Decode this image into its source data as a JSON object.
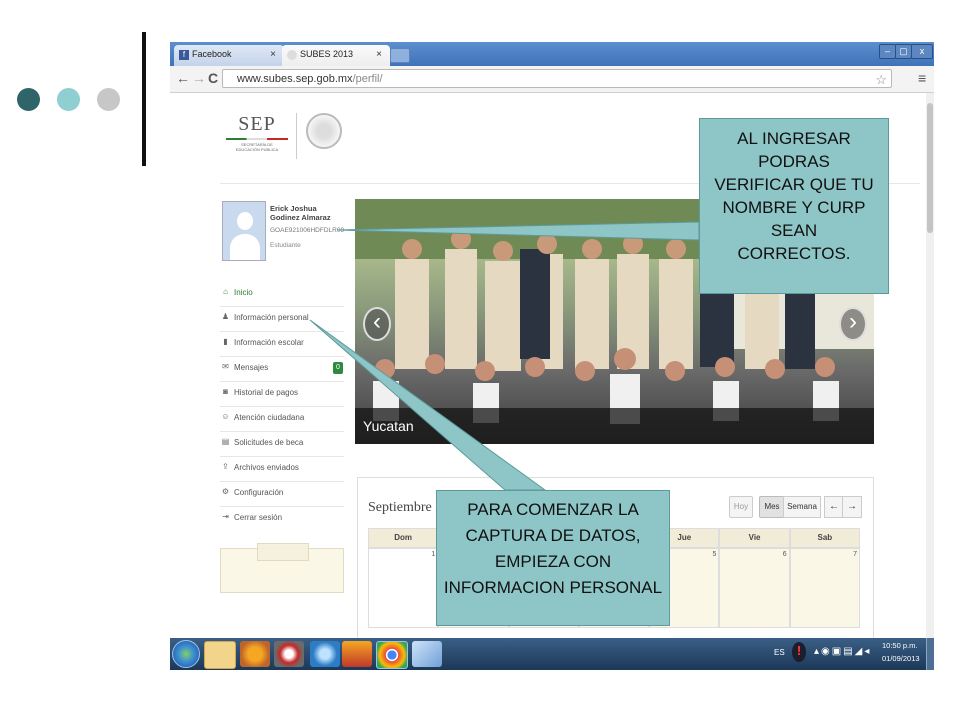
{
  "browser": {
    "tabs": [
      {
        "label": "Facebook",
        "close": "×"
      },
      {
        "label": "SUBES 2013",
        "close": "×"
      }
    ],
    "window_buttons": {
      "minimize": "–",
      "maximize": "▢",
      "close": "x"
    },
    "url_host": "www.subes.sep.gob.mx",
    "url_path": "/perfil/"
  },
  "header": {
    "logo_text": "SEP",
    "logo_sub": "SECRETARÍA DE EDUCACIÓN PÚBLICA"
  },
  "profile": {
    "name": "Erick Joshua Godinez Almaraz",
    "curp": "GOAE921006HDFDLR09",
    "role": "Estudiante"
  },
  "menu": [
    {
      "label": "Inicio",
      "icon": "home-icon",
      "glyph": "⌂"
    },
    {
      "label": "Información personal",
      "icon": "user-icon",
      "glyph": "♟"
    },
    {
      "label": "Información escolar",
      "icon": "book-icon",
      "glyph": "▮"
    },
    {
      "label": "Mensajes",
      "icon": "mail-icon",
      "glyph": "✉",
      "badge": "0"
    },
    {
      "label": "Historial de pagos",
      "icon": "history-icon",
      "glyph": "◙"
    },
    {
      "label": "Atención ciudadana",
      "icon": "chat-icon",
      "glyph": "☺"
    },
    {
      "label": "Solicitudes de beca",
      "icon": "file-icon",
      "glyph": "▤"
    },
    {
      "label": "Archivos enviados",
      "icon": "upload-icon",
      "glyph": "⇪"
    },
    {
      "label": "Configuración",
      "icon": "gear-icon",
      "glyph": "⚙"
    },
    {
      "label": "Cerrar sesión",
      "icon": "logout-icon",
      "glyph": "⇥"
    }
  ],
  "carousel": {
    "caption": "Yucatan",
    "prev": "‹",
    "next": "›"
  },
  "calendar": {
    "title": "Septiembre 20",
    "buttons": {
      "today": "Hoy",
      "month": "Mes",
      "week": "Semana",
      "prev": "←",
      "next": "→"
    },
    "days": [
      "Dom",
      "",
      "",
      "",
      "Jue",
      "Vie",
      "Sab"
    ],
    "first_row_numbers": [
      "1",
      "",
      "",
      "",
      "5",
      "6",
      "7"
    ]
  },
  "callouts": {
    "top": "AL INGRESAR PODRAS VERIFICAR QUE TU NOMBRE Y CURP SEAN CORRECTOS.",
    "bottom": "PARA COMENZAR LA CAPTURA DE DATOS, EMPIEZA CON INFORMACION PERSONAL"
  },
  "taskbar": {
    "lang": "ES",
    "time": "10:50 p.m.",
    "date": "01/09/2013"
  },
  "colors": {
    "dot1": "#2f6468",
    "dot2": "#8fcfd1",
    "dot3": "#c7c7c7",
    "callout_bg": "#8ec5c6",
    "chrome_blue": "#4a7fc1"
  }
}
